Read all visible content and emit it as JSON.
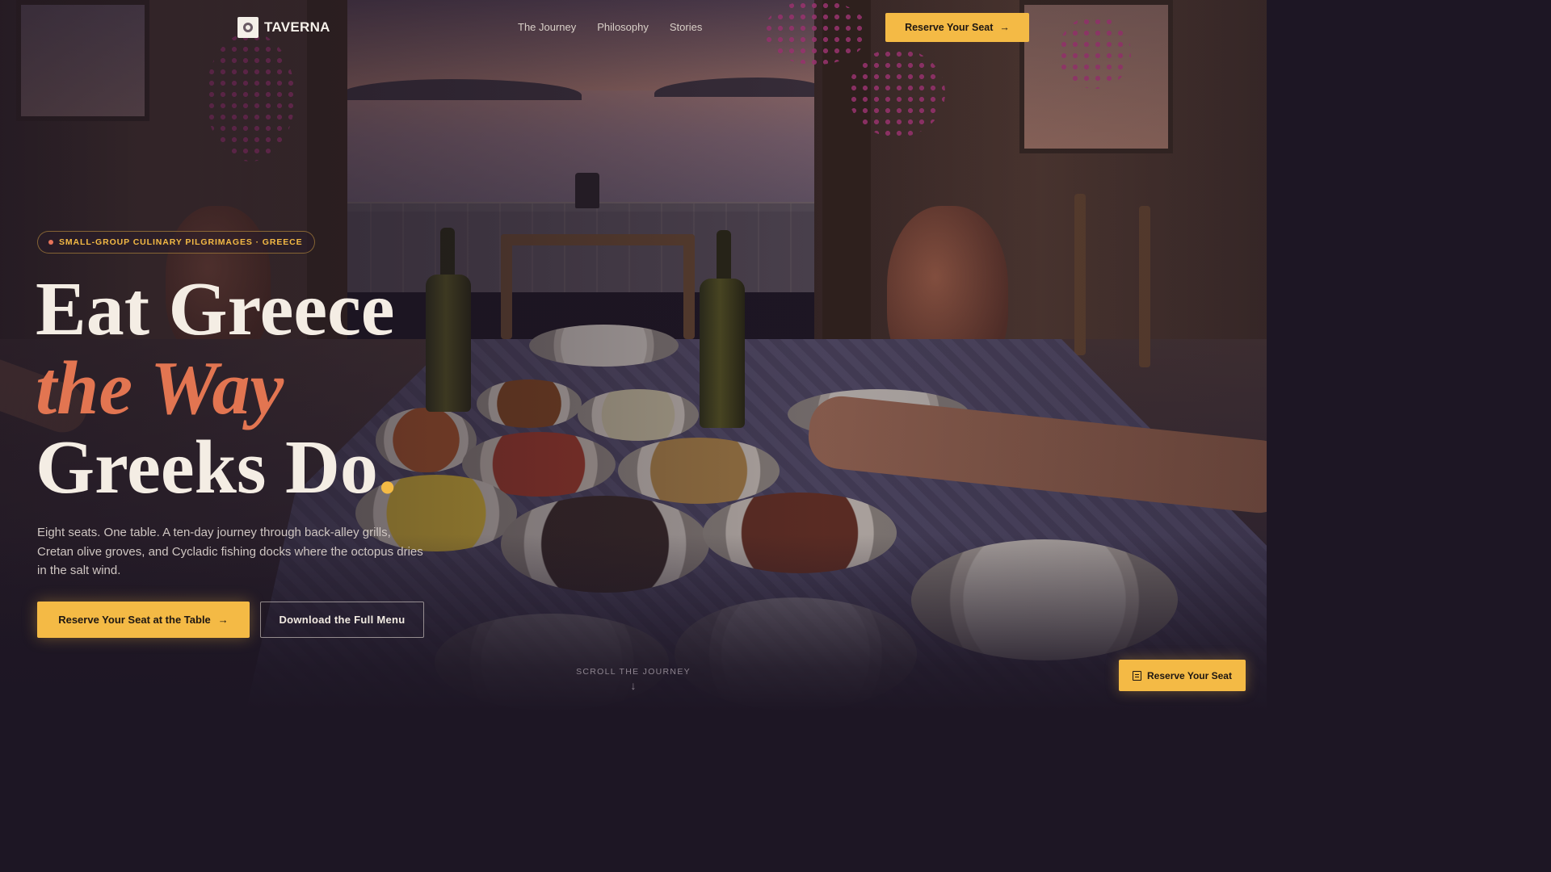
{
  "header": {
    "brand": "TAVERNA",
    "nav": [
      "The Journey",
      "Philosophy",
      "Stories"
    ],
    "cta_label": "Reserve Your Seat",
    "cta_icon": "→"
  },
  "hero": {
    "badge": "SMALL-GROUP CULINARY PILGRIMAGES · GREECE",
    "headline_line1": "Eat Greece",
    "headline_line2": "the Way",
    "headline_line3": "Greeks Do",
    "headline_period": ".",
    "lede": "Eight seats. One table. A ten-day journey through back-alley grills, Cretan olive groves, and Cycladic fishing docks where the octopus dries in the salt wind.",
    "primary_cta": "Reserve Your Seat at the Table",
    "primary_icon": "→",
    "secondary_cta": "Download the Full Menu"
  },
  "scroll": {
    "label": "SCROLL THE JOURNEY",
    "icon": "↓"
  },
  "floating_cta": {
    "label": "Reserve Your Seat",
    "icon_name": "calendar-icon"
  },
  "colors": {
    "accent_gold": "#f4ba45",
    "accent_terracotta": "#e27551",
    "background": "#1d1624"
  }
}
